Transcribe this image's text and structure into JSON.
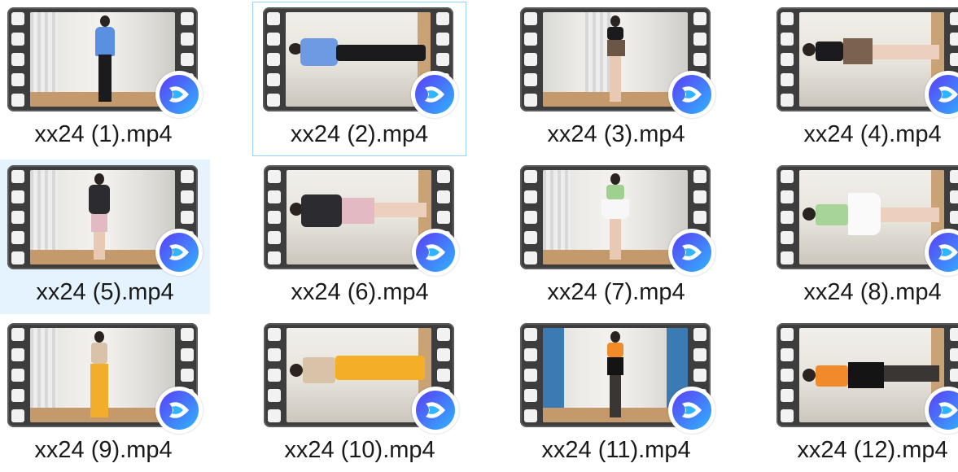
{
  "files": [
    {
      "name": "xx24 (1).mp4",
      "state": "normal"
    },
    {
      "name": "xx24 (2).mp4",
      "state": "focused"
    },
    {
      "name": "xx24 (3).mp4",
      "state": "normal"
    },
    {
      "name": "xx24 (4).mp4",
      "state": "normal"
    },
    {
      "name": "xx24 (5).mp4",
      "state": "selected"
    },
    {
      "name": "xx24 (6).mp4",
      "state": "normal"
    },
    {
      "name": "xx24 (7).mp4",
      "state": "normal"
    },
    {
      "name": "xx24 (8).mp4",
      "state": "normal"
    },
    {
      "name": "xx24 (9).mp4",
      "state": "normal"
    },
    {
      "name": "xx24 (10).mp4",
      "state": "normal"
    },
    {
      "name": "xx24 (11).mp4",
      "state": "normal"
    },
    {
      "name": "xx24 (12).mp4",
      "state": "normal"
    }
  ],
  "icons": {
    "thumbnail_frame": "film-strip-icon",
    "overlay": "video-player-app-icon"
  },
  "colors": {
    "selection_bg": "#e5f3ff",
    "focus_border": "#99d1ff",
    "badge_gradient": [
      "#5b3df5",
      "#2fb5ff"
    ]
  }
}
